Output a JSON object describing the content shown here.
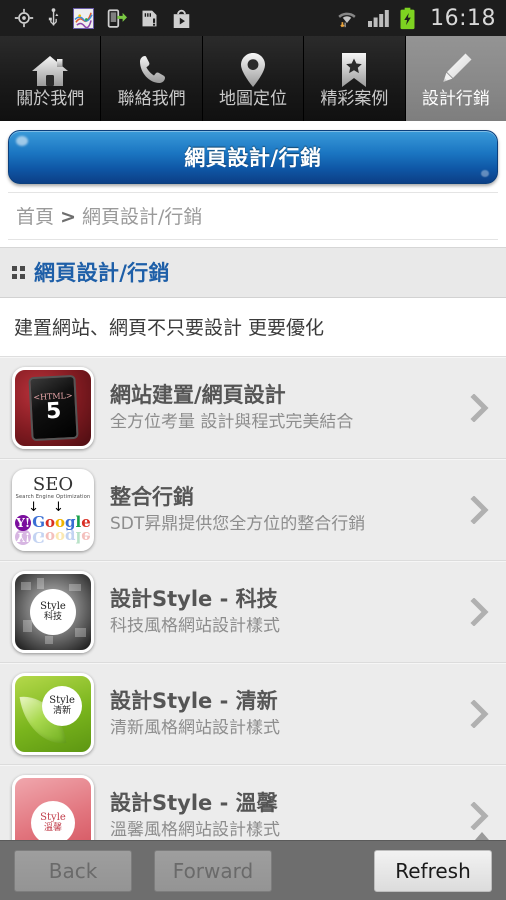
{
  "status_bar": {
    "time": "16:18",
    "left_icons": [
      "gps-icon",
      "usb-icon",
      "app-icon",
      "phone-transfer-icon",
      "sdcard-alert-icon",
      "play-store-icon"
    ],
    "right_icons": [
      "wifi-icon",
      "signal-icon",
      "battery-charging-icon"
    ]
  },
  "tabs": [
    {
      "label": "關於我們",
      "icon": "home-icon",
      "selected": false
    },
    {
      "label": "聯絡我們",
      "icon": "phone-icon",
      "selected": false
    },
    {
      "label": "地圖定位",
      "icon": "map-pin-icon",
      "selected": false
    },
    {
      "label": "精彩案例",
      "icon": "bookmark-star-icon",
      "selected": false
    },
    {
      "label": "設計行銷",
      "icon": "pencil-icon",
      "selected": true
    }
  ],
  "hero": {
    "title": "網頁設計/行銷"
  },
  "breadcrumb": {
    "home": "首頁",
    "separator": ">",
    "current": "網頁設計/行銷"
  },
  "section": {
    "title": "網頁設計/行銷",
    "icon": "grid-dots-icon"
  },
  "tagline": "建置網站、網頁不只要設計 更要優化",
  "list": [
    {
      "title": "網站建置/網頁設計",
      "desc": "全方位考量 設計與程式完美結合",
      "thumb": "html5-tablet-thumb",
      "thumb_text": {
        "tag": "<HTML>",
        "num": "5"
      }
    },
    {
      "title": "整合行銷",
      "desc": "SDT昇鼎提供您全方位的整合行銷",
      "thumb": "seo-thumb",
      "thumb_text": {
        "seo": "SEO",
        "sub": "Search Engine Optimization",
        "yahoo": "Y!",
        "google": "Google"
      }
    },
    {
      "title": "設計Style - 科技",
      "desc": "科技風格網站設計樣式",
      "thumb": "tech-style-thumb",
      "thumb_text": {
        "style": "Style",
        "cn": "科技"
      }
    },
    {
      "title": "設計Style - 清新",
      "desc": "清新風格網站設計樣式",
      "thumb": "fresh-style-thumb",
      "thumb_text": {
        "style": "Style",
        "cn": "清新"
      }
    },
    {
      "title": "設計Style - 溫馨",
      "desc": "溫馨風格網站設計樣式",
      "thumb": "warm-style-thumb",
      "thumb_text": {
        "style": "Style",
        "cn": "溫馨"
      }
    }
  ],
  "bottom_bar": {
    "back": "Back",
    "forward": "Forward",
    "refresh": "Refresh"
  },
  "colors": {
    "accent_blue": "#1e5fa8",
    "hero_blue_top": "#3a9ad9",
    "hero_blue_bottom": "#0c3f86",
    "tab_selected": "#8a8a8a",
    "bottom_bar": "#6e6e6e"
  }
}
